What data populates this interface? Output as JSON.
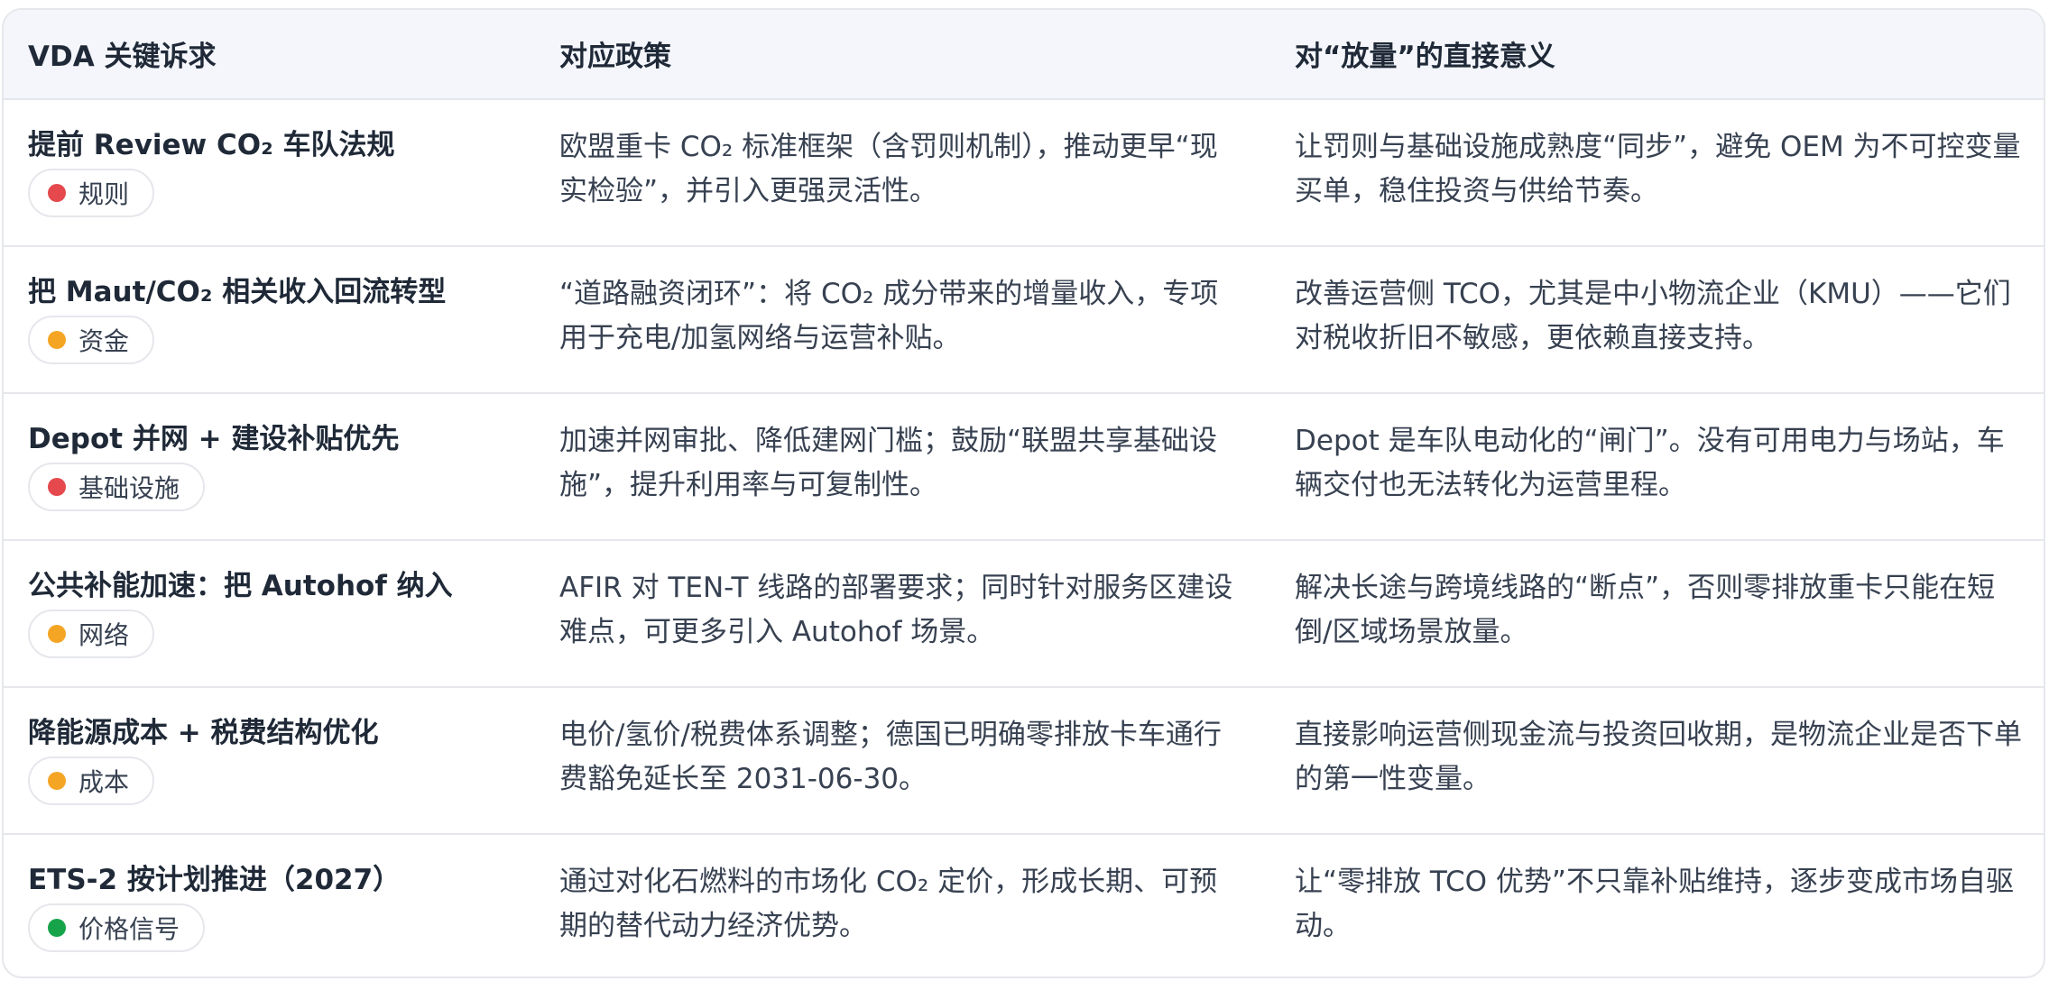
{
  "columns": [
    "VDA 关键诉求",
    "对应政策",
    "对“放量”的直接意义"
  ],
  "rows": [
    {
      "request": "提前 Review CO₂ 车队法规",
      "tag": "规则",
      "tag_color": "#e5484d",
      "policy": "欧盟重卡 CO₂ 标准框架（含罚则机制），推动更早“现实检验”，并引入更强灵活性。",
      "meaning": "让罚则与基础设施成熟度“同步”，避免 OEM 为不可控变量买单，稳住投资与供给节奏。"
    },
    {
      "request": "把 Maut/CO₂ 相关收入回流转型",
      "tag": "资金",
      "tag_color": "#f5a524",
      "policy": "“道路融资闭环”：将 CO₂ 成分带来的增量收入，专项用于充电/加氢网络与运营补贴。",
      "meaning": "改善运营侧 TCO，尤其是中小物流企业（KMU）——它们对税收折旧不敏感，更依赖直接支持。"
    },
    {
      "request": "Depot 并网 + 建设补贴优先",
      "tag": "基础设施",
      "tag_color": "#e5484d",
      "policy": "加速并网审批、降低建网门槛；鼓励“联盟共享基础设施”，提升利用率与可复制性。",
      "meaning": "Depot 是车队电动化的“闸门”。没有可用电力与场站，车辆交付也无法转化为运营里程。"
    },
    {
      "request": "公共补能加速：把 Autohof 纳入",
      "tag": "网络",
      "tag_color": "#f5a524",
      "policy": "AFIR 对 TEN-T 线路的部署要求；同时针对服务区建设难点，可更多引入 Autohof 场景。",
      "meaning": "解决长途与跨境线路的“断点”，否则零排放重卡只能在短倒/区域场景放量。"
    },
    {
      "request": "降能源成本 + 税费结构优化",
      "tag": "成本",
      "tag_color": "#f5a524",
      "policy": "电价/氢价/税费体系调整；德国已明确零排放卡车通行费豁免延长至 2031-06-30。",
      "meaning": "直接影响运营侧现金流与投资回收期，是物流企业是否下单的第一性变量。"
    },
    {
      "request": "ETS-2 按计划推进（2027）",
      "tag": "价格信号",
      "tag_color": "#16a34a",
      "policy": "通过对化石燃料的市场化 CO₂ 定价，形成长期、可预期的替代动力经济优势。",
      "meaning": "让“零排放 TCO 优势”不只靠补贴维持，逐步变成市场自驱动。"
    }
  ]
}
